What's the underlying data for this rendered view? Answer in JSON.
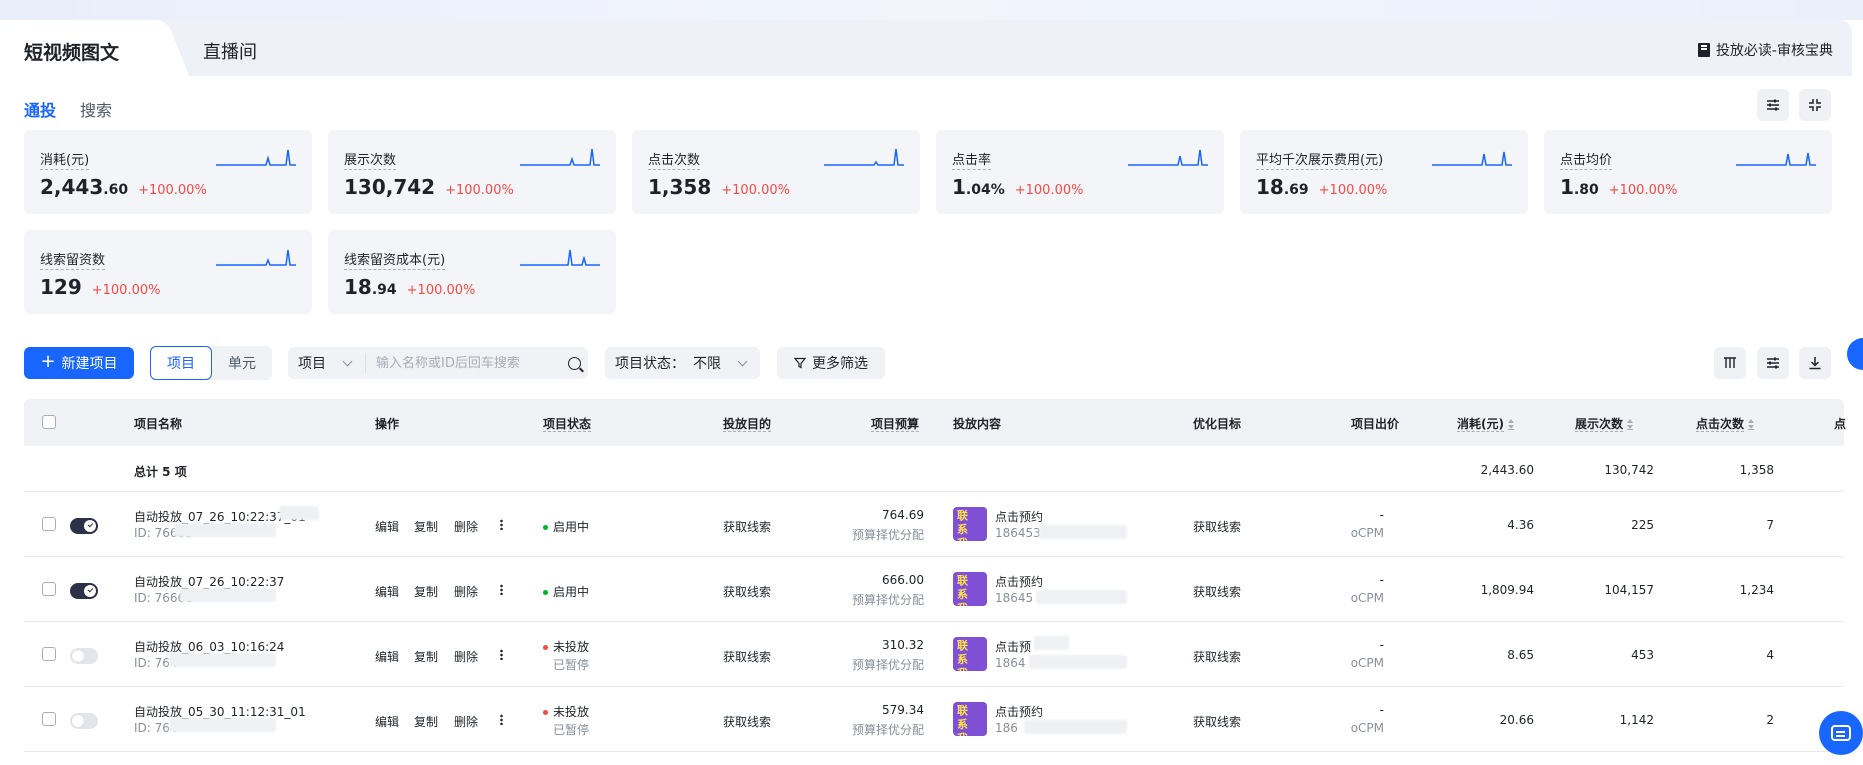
{
  "tabs": {
    "active": "短视频图文",
    "other": "直播间"
  },
  "guide_link": "投放必读-审核宝典",
  "subtabs": [
    "通投",
    "搜索"
  ],
  "metrics": [
    {
      "label": "消耗(元)",
      "int": "2,443",
      "dec": ".60",
      "change": "+100.00%"
    },
    {
      "label": "展示次数",
      "int": "130,742",
      "dec": "",
      "change": "+100.00%"
    },
    {
      "label": "点击次数",
      "int": "1,358",
      "dec": "",
      "change": "+100.00%"
    },
    {
      "label": "点击率",
      "int": "1",
      "dec": ".04%",
      "change": "+100.00%"
    },
    {
      "label": "平均千次展示费用(元)",
      "int": "18",
      "dec": ".69",
      "change": "+100.00%"
    },
    {
      "label": "点击均价",
      "int": "1",
      "dec": ".80",
      "change": "+100.00%"
    },
    {
      "label": "线索留资数",
      "int": "129",
      "dec": "",
      "change": "+100.00%"
    },
    {
      "label": "线索留资成本(元)",
      "int": "18",
      "dec": ".94",
      "change": "+100.00%"
    }
  ],
  "toolbar": {
    "new_project": "新建项目",
    "seg_project": "项目",
    "seg_unit": "单元",
    "search_type": "项目",
    "search_placeholder": "输入名称或ID后回车搜索",
    "status_label": "项目状态：",
    "status_value": "不限",
    "more_filters": "更多筛选"
  },
  "columns": {
    "name": "项目名称",
    "ops": "操作",
    "status": "项目状态",
    "purpose": "投放目的",
    "budget": "项目预算",
    "content": "投放内容",
    "goal": "优化目标",
    "bid": "项目出价",
    "cost": "消耗(元)",
    "impressions": "展示次数",
    "clicks": "点击次数",
    "more": "点"
  },
  "total": {
    "label": "总计 5 项",
    "cost": "2,443.60",
    "impressions": "130,742",
    "clicks": "1,358"
  },
  "row_ops": {
    "edit": "编辑",
    "copy": "复制",
    "delete": "删除"
  },
  "rows": [
    {
      "name": "自动投放_07_26_10:22:37_01",
      "id": "ID: 76685",
      "on": true,
      "status": "启用中",
      "status_color": "#00b42a",
      "status_sub": "",
      "purpose": "获取线索",
      "budget": "764.69",
      "budget_sub": "预算择优分配",
      "content_title": "点击预约",
      "content_id": "186453",
      "thumb": "联系我们",
      "goal": "获取线索",
      "bid": "-",
      "bid_sub": "oCPM",
      "cost": "4.36",
      "impressions": "225",
      "clicks": "7"
    },
    {
      "name": "自动投放_07_26_10:22:37",
      "id": "ID: 76666",
      "on": true,
      "status": "启用中",
      "status_color": "#00b42a",
      "status_sub": "",
      "purpose": "获取线索",
      "budget": "666.00",
      "budget_sub": "预算择优分配",
      "content_title": "点击预约",
      "content_id": "18645",
      "thumb": "联系我们",
      "goal": "获取线索",
      "bid": "-",
      "bid_sub": "oCPM",
      "cost": "1,809.94",
      "impressions": "104,157",
      "clicks": "1,234"
    },
    {
      "name": "自动投放_06_03_10:16:24",
      "id": "ID: 764",
      "on": false,
      "status": "未投放",
      "status_color": "#f54a45",
      "status_sub": "已暂停",
      "purpose": "获取线索",
      "budget": "310.32",
      "budget_sub": "预算择优分配",
      "content_title": "点击预",
      "content_id": "1864",
      "thumb": "联系我们",
      "goal": "获取线索",
      "bid": "-",
      "bid_sub": "oCPM",
      "cost": "8.65",
      "impressions": "453",
      "clicks": "4"
    },
    {
      "name": "自动投放_05_30_11:12:31_01",
      "id": "ID: 764",
      "on": false,
      "status": "未投放",
      "status_color": "#f54a45",
      "status_sub": "已暂停",
      "purpose": "获取线索",
      "budget": "579.34",
      "budget_sub": "预算择优分配",
      "content_title": "点击预约",
      "content_id": "186",
      "thumb": "联系我们",
      "goal": "获取线索",
      "bid": "-",
      "bid_sub": "oCPM",
      "cost": "20.66",
      "impressions": "1,142",
      "clicks": "2"
    }
  ],
  "colors": {
    "accent": "#1966ff",
    "positive_change": "#f54a45",
    "active_status": "#00b42a"
  },
  "icons": [
    "book-icon",
    "filter-settings-icon",
    "collapse-icon",
    "plus-icon",
    "chevron-down-icon",
    "search-icon",
    "funnel-icon",
    "columns-icon",
    "settings-icon",
    "download-icon",
    "more-vertical-icon",
    "chat-icon"
  ]
}
